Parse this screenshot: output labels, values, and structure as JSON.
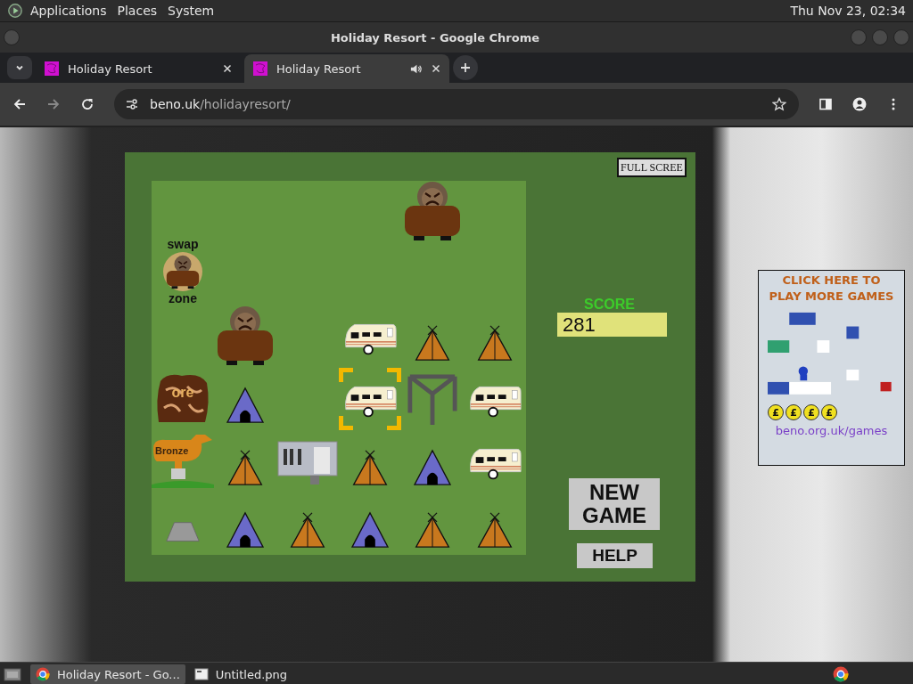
{
  "top_panel": {
    "menus": [
      "Applications",
      "Places",
      "System"
    ],
    "clock": "Thu Nov 23, 02:34"
  },
  "window": {
    "title": "Holiday Resort - Google Chrome"
  },
  "tabs": [
    {
      "title": "Holiday Resort",
      "selected": false,
      "audio": false
    },
    {
      "title": "Holiday Resort",
      "selected": true,
      "audio": true
    }
  ],
  "address_bar": {
    "domain": "beno.uk",
    "path": "/holidayresort/"
  },
  "game": {
    "full_screen_button": "FULL SCREE",
    "score_label": "SCORE",
    "score": "281",
    "buttons": [
      "NEW GAME",
      "HELP"
    ],
    "grid": [
      [
        {
          "kind": "empty",
          "selected": false
        },
        {
          "kind": "empty",
          "selected": false
        },
        {
          "kind": "empty",
          "selected": false
        },
        {
          "kind": "empty",
          "selected": false
        },
        {
          "kind": "bear",
          "selected": false
        },
        {
          "kind": "empty",
          "selected": false
        }
      ],
      [
        {
          "kind": "swap",
          "label_top": "swap",
          "label_bottom": "zone",
          "selected": false
        },
        {
          "kind": "empty",
          "selected": false
        },
        {
          "kind": "empty",
          "selected": false
        },
        {
          "kind": "empty",
          "selected": false
        },
        {
          "kind": "empty",
          "selected": false
        },
        {
          "kind": "empty",
          "selected": false
        }
      ],
      [
        {
          "kind": "empty",
          "selected": false
        },
        {
          "kind": "bear",
          "selected": false
        },
        {
          "kind": "empty",
          "selected": false
        },
        {
          "kind": "caravan",
          "selected": false
        },
        {
          "kind": "tipi",
          "selected": false
        },
        {
          "kind": "tipi",
          "selected": false
        }
      ],
      [
        {
          "kind": "ore",
          "label": "ore",
          "selected": false
        },
        {
          "kind": "tent",
          "selected": false
        },
        {
          "kind": "empty",
          "selected": false
        },
        {
          "kind": "caravan",
          "selected": true
        },
        {
          "kind": "gazebo",
          "selected": false
        },
        {
          "kind": "caravan",
          "selected": false
        }
      ],
      [
        {
          "kind": "trophy",
          "label": "Bronze",
          "selected": false
        },
        {
          "kind": "tipi",
          "selected": false
        },
        {
          "kind": "cabin",
          "selected": false
        },
        {
          "kind": "tipi",
          "selected": false
        },
        {
          "kind": "tent",
          "selected": false
        },
        {
          "kind": "caravan",
          "selected": false
        }
      ],
      [
        {
          "kind": "rock",
          "selected": false
        },
        {
          "kind": "tent",
          "selected": false
        },
        {
          "kind": "tipi",
          "selected": false
        },
        {
          "kind": "tent",
          "selected": false
        },
        {
          "kind": "tipi",
          "selected": false
        },
        {
          "kind": "tipi",
          "selected": false
        }
      ]
    ]
  },
  "ad": {
    "headline": "CLICK HERE TO PLAY MORE GAMES",
    "coins": [
      "£",
      "£",
      "£",
      "£"
    ],
    "link": "beno.org.uk/games"
  },
  "taskbar": [
    {
      "label": "Holiday Resort - Go...",
      "selected": true
    },
    {
      "label": "Untitled.png",
      "selected": false
    }
  ]
}
